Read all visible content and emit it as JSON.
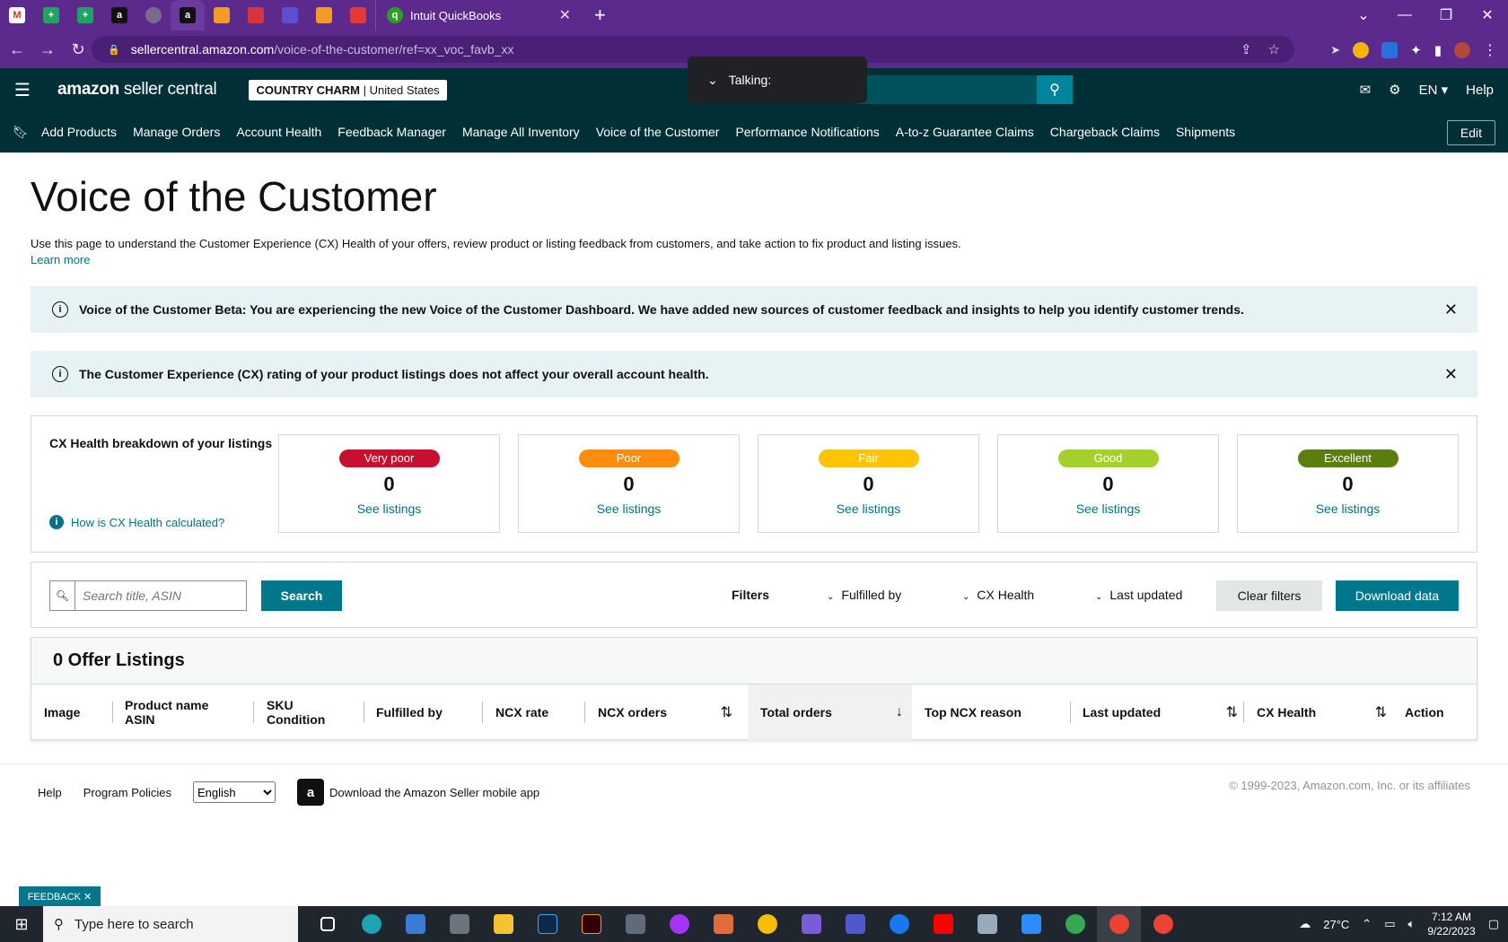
{
  "browser": {
    "tab_title": "Intuit QuickBooks",
    "tab_close": "✕",
    "new_tab": "+",
    "url_host": "sellercentral.amazon.com",
    "url_path": "/voice-of-the-customer/ref=xx_voc_favb_xx"
  },
  "header": {
    "logo_main": "amazon",
    "logo_sub": " seller central",
    "store_name": "COUNTRY CHARM",
    "store_region": "United States",
    "language": "EN",
    "help": "Help",
    "talking_popup": "Talking:"
  },
  "nav": {
    "items": [
      "Add Products",
      "Manage Orders",
      "Account Health",
      "Feedback Manager",
      "Manage All Inventory",
      "Voice of the Customer",
      "Performance Notifications",
      "A-to-z Guarantee Claims",
      "Chargeback Claims",
      "Shipments"
    ],
    "edit": "Edit"
  },
  "page": {
    "title": "Voice of the Customer",
    "description": "Use this page to understand the Customer Experience (CX) Health of your offers, review product or listing feedback from customers, and take action to fix product and listing issues.",
    "learn_more": "Learn more"
  },
  "alerts": {
    "beta": "Voice of the Customer Beta: You are experiencing the new Voice of the Customer Dashboard. We have added new sources of customer feedback and insights to help you identify customer trends.",
    "cx_rating": "The Customer Experience (CX) rating of your product listings does not affect your overall account health."
  },
  "cx_health": {
    "label": "CX Health breakdown of your listings",
    "how_link": "How is CX Health calculated?",
    "cards": [
      {
        "label": "Very poor",
        "count": "0",
        "link": "See listings",
        "color": "#c7102e"
      },
      {
        "label": "Poor",
        "count": "0",
        "link": "See listings",
        "color": "#ff8b0f"
      },
      {
        "label": "Fair",
        "count": "0",
        "link": "See listings",
        "color": "#ffc400"
      },
      {
        "label": "Good",
        "count": "0",
        "link": "See listings",
        "color": "#a4d02b"
      },
      {
        "label": "Excellent",
        "count": "0",
        "link": "See listings",
        "color": "#5a7f0e"
      }
    ]
  },
  "filters": {
    "search_placeholder": "Search title, ASIN",
    "search_button": "Search",
    "filters_label": "Filters",
    "fulfilled_by": "Fulfilled by",
    "cx_health": "CX Health",
    "last_updated": "Last updated",
    "clear": "Clear filters",
    "download": "Download data"
  },
  "listings": {
    "heading": "0 Offer Listings",
    "columns": {
      "image": "Image",
      "product_name": "Product name",
      "asin": "ASIN",
      "sku": "SKU",
      "condition": "Condition",
      "fulfilled_by": "Fulfilled by",
      "ncx_rate": "NCX rate",
      "ncx_orders": "NCX orders",
      "total_orders": "Total orders",
      "top_ncx_reason": "Top NCX reason",
      "last_updated": "Last updated",
      "cx_health": "CX Health",
      "action": "Action"
    }
  },
  "footer": {
    "help": "Help",
    "policies": "Program Policies",
    "language": "English",
    "app_text": "Download the Amazon Seller mobile app",
    "copyright": "© 1999-2023, Amazon.com, Inc. or its affiliates",
    "feedback": "FEEDBACK ✕"
  },
  "taskbar": {
    "search": "Type here to search",
    "temperature": "27°C",
    "time": "7:12 AM",
    "date": "9/22/2023"
  }
}
